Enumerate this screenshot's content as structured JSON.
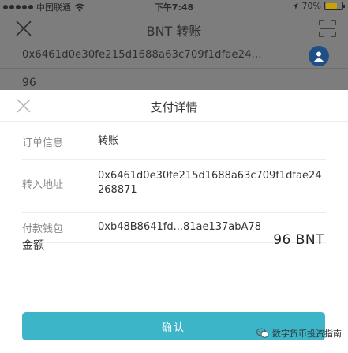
{
  "status_bar": {
    "carrier": "中国联通",
    "time": "下午7:48",
    "battery_text": "70%",
    "battery_level": 0.7
  },
  "transfer": {
    "title": "BNT 转账",
    "to_address": "0x6461d0e30fe215d1688a63c709f1dfae24...",
    "amount": "96"
  },
  "payment_sheet": {
    "title": "支付详情",
    "order_label": "订单信息",
    "order_value": "转账",
    "to_label": "转入地址",
    "to_value": "0x6461d0e30fe215d1688a63c709f1dfae24268871",
    "from_label": "付款钱包",
    "from_value": "0xb48B8641fd...81ae137abA78",
    "amount_label": "金额",
    "amount_value": "96 BNT",
    "confirm_label": "确认"
  },
  "watermark": {
    "text": "数字货币投资指南",
    "icon": "wechat-icon"
  },
  "colors": {
    "accent": "#3cb5c8",
    "overlay_bg": "#7d7d7d",
    "contact_bg": "#1f4f86"
  }
}
